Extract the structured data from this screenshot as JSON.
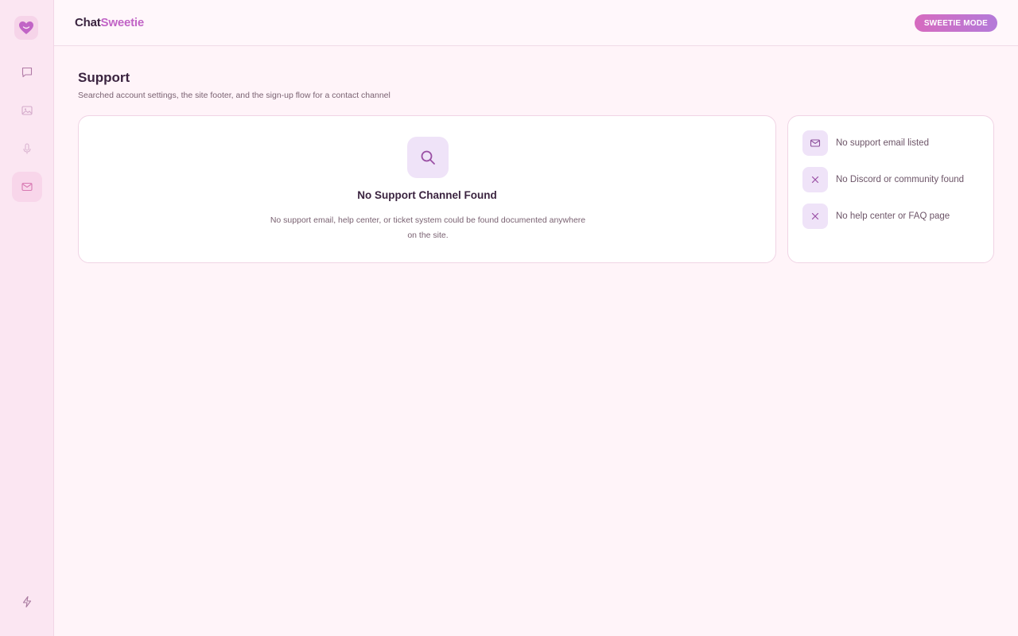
{
  "app": {
    "brand_part1": "Chat",
    "brand_part2": "Sweetie",
    "mode_button": "SWEETIE MODE"
  },
  "sidebar": {
    "items": [
      {
        "icon": "chat-bubble-icon",
        "active": false
      },
      {
        "icon": "image-icon",
        "active": false
      },
      {
        "icon": "microphone-icon",
        "active": false
      },
      {
        "icon": "mail-icon",
        "active": true
      }
    ],
    "bottom_icon": "lightning-icon"
  },
  "page": {
    "title": "Support",
    "subtitle": "Searched account settings, the site footer, and the sign-up flow for a contact channel"
  },
  "empty_state": {
    "icon": "search-icon",
    "title": "No Support Channel Found",
    "description": "No support email, help center, or ticket system could be found documented anywhere on the site."
  },
  "checks": [
    {
      "icon": "mail-icon",
      "label": "No support email listed"
    },
    {
      "icon": "x-icon",
      "label": "No Discord or community found"
    },
    {
      "icon": "x-icon",
      "label": "No help center or FAQ page"
    }
  ],
  "colors": {
    "accent": "#c164c6",
    "background": "#fff4f9",
    "sidebar": "#fbe6f2",
    "icon_tile": "#efe3f8"
  }
}
